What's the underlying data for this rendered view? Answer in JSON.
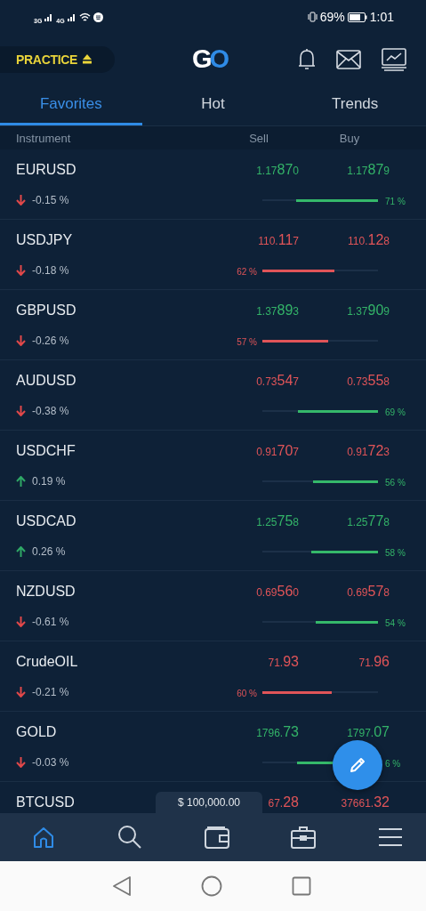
{
  "status_bar": {
    "signal_1": "3G",
    "signal_2": "4G",
    "battery": "69%",
    "time": "1:01"
  },
  "header": {
    "account_mode": "PRACTICE",
    "logo": [
      "G",
      "O"
    ]
  },
  "tabs": [
    {
      "label": "Favorites",
      "selected": true
    },
    {
      "label": "Hot",
      "selected": false
    },
    {
      "label": "Trends",
      "selected": false
    }
  ],
  "columns": {
    "instrument": "Instrument",
    "sell": "Sell",
    "buy": "Buy"
  },
  "rows": [
    {
      "name": "EURUSD",
      "price_up": true,
      "change_up": false,
      "change": "-0.15 %",
      "sell": {
        "pre": "1.17",
        "big": "87",
        "post": "0"
      },
      "buy": {
        "pre": "1.17",
        "big": "87",
        "post": "9"
      },
      "buy_majority": true,
      "level": 0.71,
      "share": "71 %"
    },
    {
      "name": "USDJPY",
      "price_up": false,
      "change_up": false,
      "change": "-0.18 %",
      "sell": {
        "pre": "110.",
        "big": "11",
        "post": "7"
      },
      "buy": {
        "pre": "110.",
        "big": "12",
        "post": "8"
      },
      "buy_majority": false,
      "level": 0.62,
      "share": "62 %"
    },
    {
      "name": "GBPUSD",
      "price_up": true,
      "change_up": false,
      "change": "-0.26 %",
      "sell": {
        "pre": "1.37",
        "big": "89",
        "post": "3"
      },
      "buy": {
        "pre": "1.37",
        "big": "90",
        "post": "9"
      },
      "buy_majority": false,
      "level": 0.57,
      "share": "57 %"
    },
    {
      "name": "AUDUSD",
      "price_up": false,
      "change_up": false,
      "change": "-0.38 %",
      "sell": {
        "pre": "0.73",
        "big": "54",
        "post": "7"
      },
      "buy": {
        "pre": "0.73",
        "big": "55",
        "post": "8"
      },
      "buy_majority": true,
      "level": 0.69,
      "share": "69 %"
    },
    {
      "name": "USDCHF",
      "price_up": false,
      "change_up": true,
      "change": "0.19 %",
      "sell": {
        "pre": "0.91",
        "big": "70",
        "post": "7"
      },
      "buy": {
        "pre": "0.91",
        "big": "72",
        "post": "3"
      },
      "buy_majority": true,
      "level": 0.56,
      "share": "56 %"
    },
    {
      "name": "USDCAD",
      "price_up": true,
      "change_up": true,
      "change": "0.26 %",
      "sell": {
        "pre": "1.25",
        "big": "75",
        "post": "8"
      },
      "buy": {
        "pre": "1.25",
        "big": "77",
        "post": "8"
      },
      "buy_majority": true,
      "level": 0.58,
      "share": "58 %"
    },
    {
      "name": "NZDUSD",
      "price_up": false,
      "change_up": false,
      "change": "-0.61 %",
      "sell": {
        "pre": "0.69",
        "big": "56",
        "post": "0"
      },
      "buy": {
        "pre": "0.69",
        "big": "57",
        "post": "8"
      },
      "buy_majority": true,
      "level": 0.54,
      "share": "54 %"
    },
    {
      "name": "CrudeOIL",
      "price_up": false,
      "change_up": false,
      "change": "-0.21 %",
      "sell": {
        "pre": "71.",
        "big": "93"
      },
      "buy": {
        "pre": "71.",
        "big": "96"
      },
      "buy_majority": false,
      "level": 0.6,
      "share": "60 %"
    },
    {
      "name": "GOLD",
      "price_up": true,
      "change_up": false,
      "change": "-0.03 %",
      "sell": {
        "pre": "1796.",
        "big": "73"
      },
      "buy": {
        "pre": "1797.",
        "big": "07"
      },
      "buy_majority": true,
      "level": 0.7,
      "share": "6 %"
    },
    {
      "name": "BTCUSD",
      "price_up": false,
      "sell": {
        "pre": "67.",
        "big": "28"
      },
      "buy": {
        "pre": "37661.",
        "big": "32"
      }
    }
  ],
  "balance": "$ 100,000.00",
  "nav": [
    {
      "kind": "home",
      "selected": true
    },
    {
      "kind": "search",
      "selected": false
    },
    {
      "kind": "wallet",
      "selected": false
    },
    {
      "kind": "briefcase",
      "selected": false
    },
    {
      "kind": "menu",
      "selected": false
    }
  ]
}
